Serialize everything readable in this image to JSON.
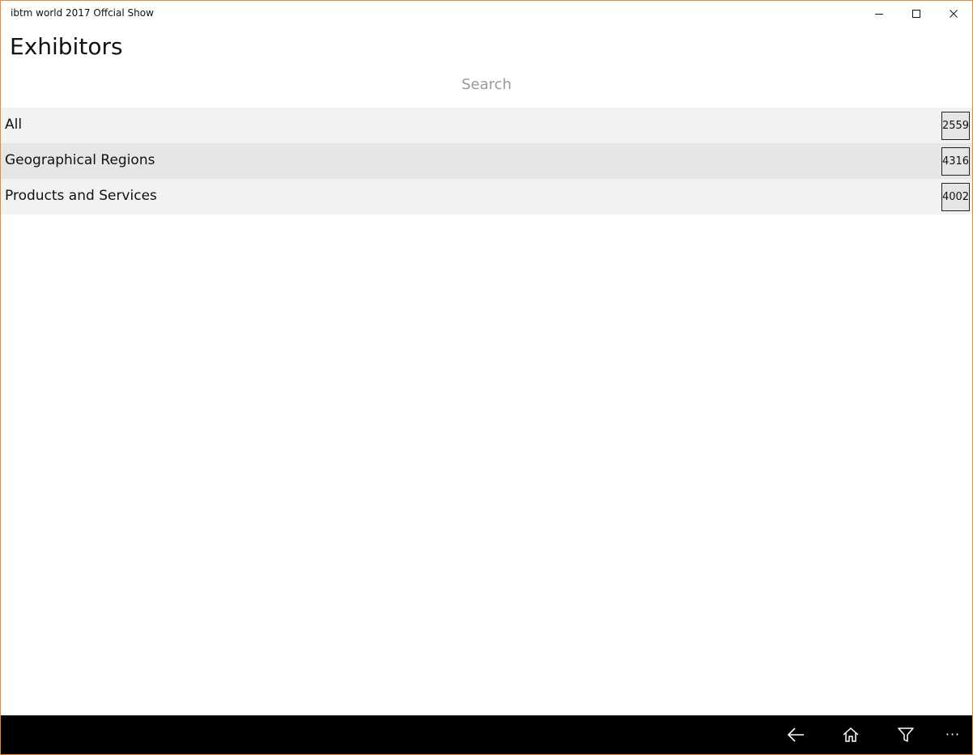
{
  "window": {
    "title": "ibtm world 2017 Offcial Show"
  },
  "page": {
    "title": "Exhibitors"
  },
  "search": {
    "placeholder": "Search",
    "value": ""
  },
  "list": {
    "items": [
      {
        "label": "All",
        "count": "2559"
      },
      {
        "label": "Geographical Regions",
        "count": "4316"
      },
      {
        "label": "Products and Services",
        "count": "4002"
      }
    ]
  },
  "bottom_bar": {
    "buttons": [
      {
        "icon": "back-arrow-icon"
      },
      {
        "icon": "home-icon"
      },
      {
        "icon": "filter-icon"
      },
      {
        "icon": "more-icon",
        "label": "···"
      }
    ]
  },
  "colors": {
    "window_border": "#e08a3c",
    "row_odd": "#f2f2f2",
    "row_even": "#e6e6e6",
    "bottom_bar": "#000000"
  }
}
